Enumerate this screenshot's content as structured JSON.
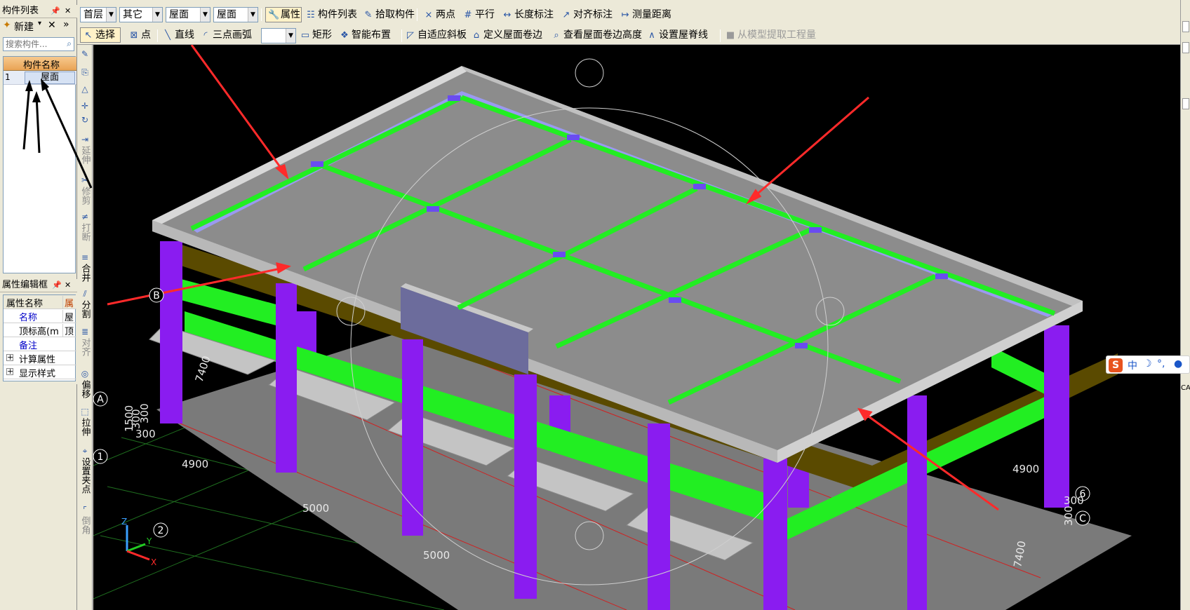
{
  "left_panel": {
    "component_list": {
      "title": "构件列表",
      "pin_glyph": "P",
      "close_glyph": "✕",
      "new_button": "新建",
      "delete_glyph": "✕",
      "more_glyph": "»",
      "search_placeholder": "搜索构件...",
      "header_name": "构件名称",
      "rows": [
        {
          "num": "1",
          "name": "屋面"
        }
      ]
    },
    "property_editor": {
      "title": "属性编辑框",
      "header_key": "属性名称",
      "header_value": "属",
      "rows": [
        {
          "key": "名称",
          "value": "屋"
        },
        {
          "key": "顶标高(m",
          "value": "顶"
        },
        {
          "key": "备注",
          "value": ""
        },
        {
          "key": "计算属性",
          "value": ""
        },
        {
          "key": "显示样式",
          "value": ""
        }
      ],
      "expand_glyph": "+"
    }
  },
  "toolbar_top": {
    "floor_select": "首层",
    "type_select": "其它",
    "component_select": "屋面",
    "instance_select": "屋面",
    "properties_button": "属性",
    "component_list_button": "构件列表",
    "pick_button": "拾取构件",
    "two_point_button": "两点",
    "parallel_button": "平行",
    "length_dim_button": "长度标注",
    "align_dim_button": "对齐标注",
    "measure_button": "测量距离"
  },
  "toolbar_2": {
    "select_button": "选择",
    "point_button": "点",
    "line_button": "直线",
    "arc_button": "三点画弧",
    "empty_select": "",
    "rect_button": "矩形",
    "smart_layout_button": "智能布置",
    "adaptive_slope_button": "自适应斜板",
    "define_roof_edge_button": "定义屋面卷边",
    "view_roof_edge_height_button": "查看屋面卷边高度",
    "set_ridge_button": "设置屋脊线",
    "extract_qty_button": "从模型提取工程量"
  },
  "vertical_tools": [
    {
      "label": "延伸"
    },
    {
      "label": "修剪"
    },
    {
      "label": "打断"
    },
    {
      "label": "合并"
    },
    {
      "label": "分割"
    },
    {
      "label": "对齐"
    },
    {
      "label": "偏移"
    },
    {
      "label": "拉伸"
    },
    {
      "label": "设置夹点"
    },
    {
      "label": "倒角"
    }
  ],
  "viewport": {
    "dims": {
      "d4900_left": "4900",
      "d5000_a": "5000",
      "d5000_b": "5000",
      "d7400_left": "7400",
      "d1500": "1500",
      "d300_a": "300",
      "d300_b": "300",
      "d300_c": "300",
      "d300_right": "300",
      "d4900_right": "4900",
      "d7400_right": "7400",
      "d300_right2": "300"
    },
    "axis_labels": {
      "a": "A",
      "one": "1",
      "two": "2",
      "b": "B",
      "six": "6",
      "c": "C"
    },
    "ucs": {
      "z": "Z",
      "y": "Y",
      "x": "X"
    }
  },
  "ime": {
    "logo": "S",
    "lang": "中",
    "moon": "☽",
    "punct": "°,",
    "mic": "●"
  },
  "colors": {
    "roof": "#8c8c8c",
    "parapet": "#c8c8c8",
    "gutter": "#9a9af0",
    "beam": "#22ee22",
    "column": "#8a1cf0",
    "edge_beam": "#5a4a00",
    "arrow": "#ff2a2a"
  }
}
